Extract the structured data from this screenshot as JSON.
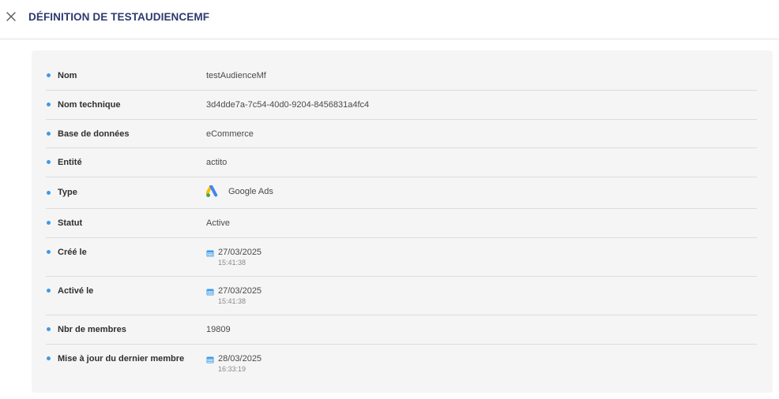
{
  "header": {
    "title": "DÉFINITION DE TESTAUDIENCEMF"
  },
  "colors": {
    "title": "#2d3a6e",
    "bullet": "#3d9ae8",
    "panel": "#f5f5f5"
  },
  "fields": {
    "name": {
      "label": "Nom",
      "value": "testAudienceMf"
    },
    "technical_name": {
      "label": "Nom technique",
      "value": "3d4dde7a-7c54-40d0-9204-8456831a4fc4"
    },
    "database": {
      "label": "Base de données",
      "value": "eCommerce"
    },
    "entity": {
      "label": "Entité",
      "value": "actito"
    },
    "type": {
      "label": "Type",
      "value": "Google Ads",
      "icon": "google-ads-logo"
    },
    "status": {
      "label": "Statut",
      "value": "Active"
    },
    "created": {
      "label": "Créé le",
      "date": "27/03/2025",
      "time": "15:41:38",
      "icon": "calendar-icon"
    },
    "activated": {
      "label": "Activé le",
      "date": "27/03/2025",
      "time": "15:41:38",
      "icon": "calendar-icon"
    },
    "members": {
      "label": "Nbr de membres",
      "value": "19809"
    },
    "last_member_update": {
      "label": "Mise à jour du dernier membre",
      "date": "28/03/2025",
      "time": "16:33:19",
      "icon": "calendar-icon"
    }
  }
}
